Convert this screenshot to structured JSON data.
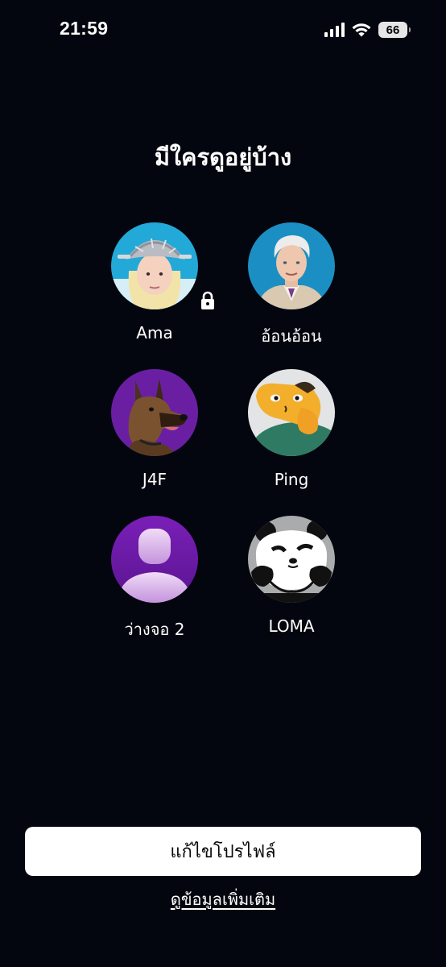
{
  "status_bar": {
    "time": "21:59",
    "battery_level": "66",
    "icons": [
      "cellular-signal-icon",
      "wifi-icon",
      "battery-icon"
    ]
  },
  "title": "มีใครดูอยู่บ้าง",
  "profiles": [
    {
      "name": "Ama",
      "avatar": "girl-with-colander-avatar",
      "locked": true
    },
    {
      "name": "อ้อนอ้อน",
      "avatar": "man-white-hair-avatar",
      "locked": false
    },
    {
      "name": "J4F",
      "avatar": "dog-avatar",
      "locked": false
    },
    {
      "name": "Ping",
      "avatar": "orange-character-avatar",
      "locked": false
    },
    {
      "name": "ว่างจอ 2",
      "avatar": "default-person-avatar",
      "locked": false
    },
    {
      "name": "LOMA",
      "avatar": "panda-avatar",
      "locked": false
    }
  ],
  "actions": {
    "edit_profile": "แก้ไขโปรไฟล์",
    "more_info": "ดูข้อมูลเพิ่มเติม"
  },
  "colors": {
    "background": "#04060f",
    "avatar_purple": "#6a1fa3",
    "avatar_blue": "#1b9fd0"
  }
}
